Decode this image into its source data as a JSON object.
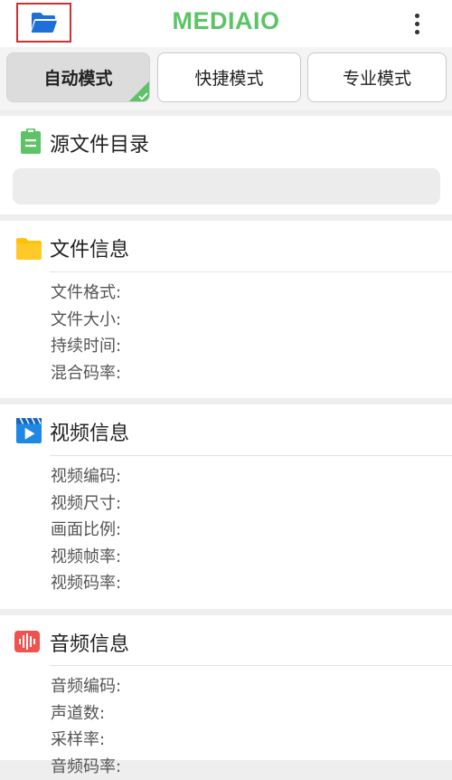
{
  "header": {
    "title": "MEDIAIO",
    "open_folder_icon": "folder-open-icon",
    "menu_icon": "more-vertical-icon",
    "accent_color": "#5cc466"
  },
  "tabs": [
    {
      "label": "自动模式",
      "active": true
    },
    {
      "label": "快捷模式",
      "active": false
    },
    {
      "label": "专业模式",
      "active": false
    }
  ],
  "source_dir": {
    "title": "源文件目录",
    "icon": "clipboard-icon",
    "value": ""
  },
  "file_info": {
    "title": "文件信息",
    "icon": "folder-icon",
    "fields": [
      "文件格式:",
      "文件大小:",
      "持续时间:",
      "混合码率:"
    ]
  },
  "video_info": {
    "title": "视频信息",
    "icon": "video-play-icon",
    "fields": [
      "视频编码:",
      "视频尺寸:",
      "画面比例:",
      "视频帧率:",
      "视频码率:"
    ]
  },
  "audio_info": {
    "title": "音频信息",
    "icon": "audio-wave-icon",
    "fields": [
      "音频编码:",
      "声道数:",
      "采样率:",
      "音频码率:"
    ]
  }
}
